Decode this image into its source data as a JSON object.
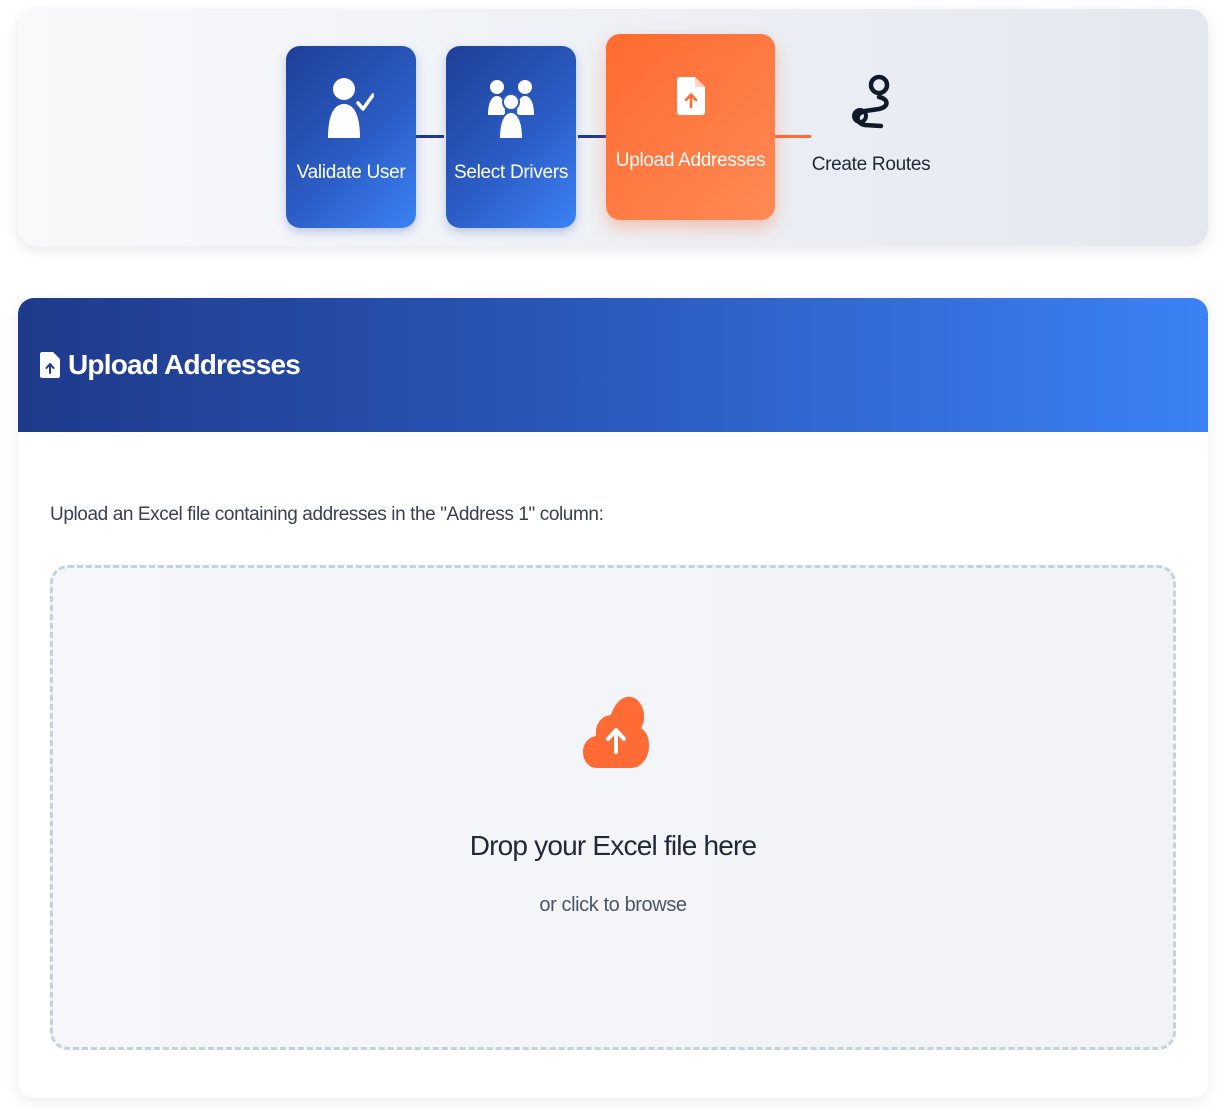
{
  "stepper": {
    "steps": [
      {
        "label": "Validate User",
        "icon": "user-check-icon",
        "state": "completed"
      },
      {
        "label": "Select Drivers",
        "icon": "users-icon",
        "state": "completed"
      },
      {
        "label": "Upload Addresses",
        "icon": "file-upload-icon",
        "state": "active"
      },
      {
        "label": "Create Routes",
        "icon": "route-icon",
        "state": "pending"
      }
    ]
  },
  "upload_panel": {
    "title": "Upload Addresses",
    "icon": "file-upload-icon",
    "instruction": "Upload an Excel file containing addresses in the \"Address 1\" column:",
    "dropzone": {
      "icon": "cloud-upload-icon",
      "title": "Drop your Excel file here",
      "subtitle": "or click to browse"
    }
  },
  "colors": {
    "primary_dark": "#1e3a8a",
    "primary_light": "#3b82f6",
    "accent_orange": "#ff6b35",
    "text_dark": "#1f2937"
  }
}
